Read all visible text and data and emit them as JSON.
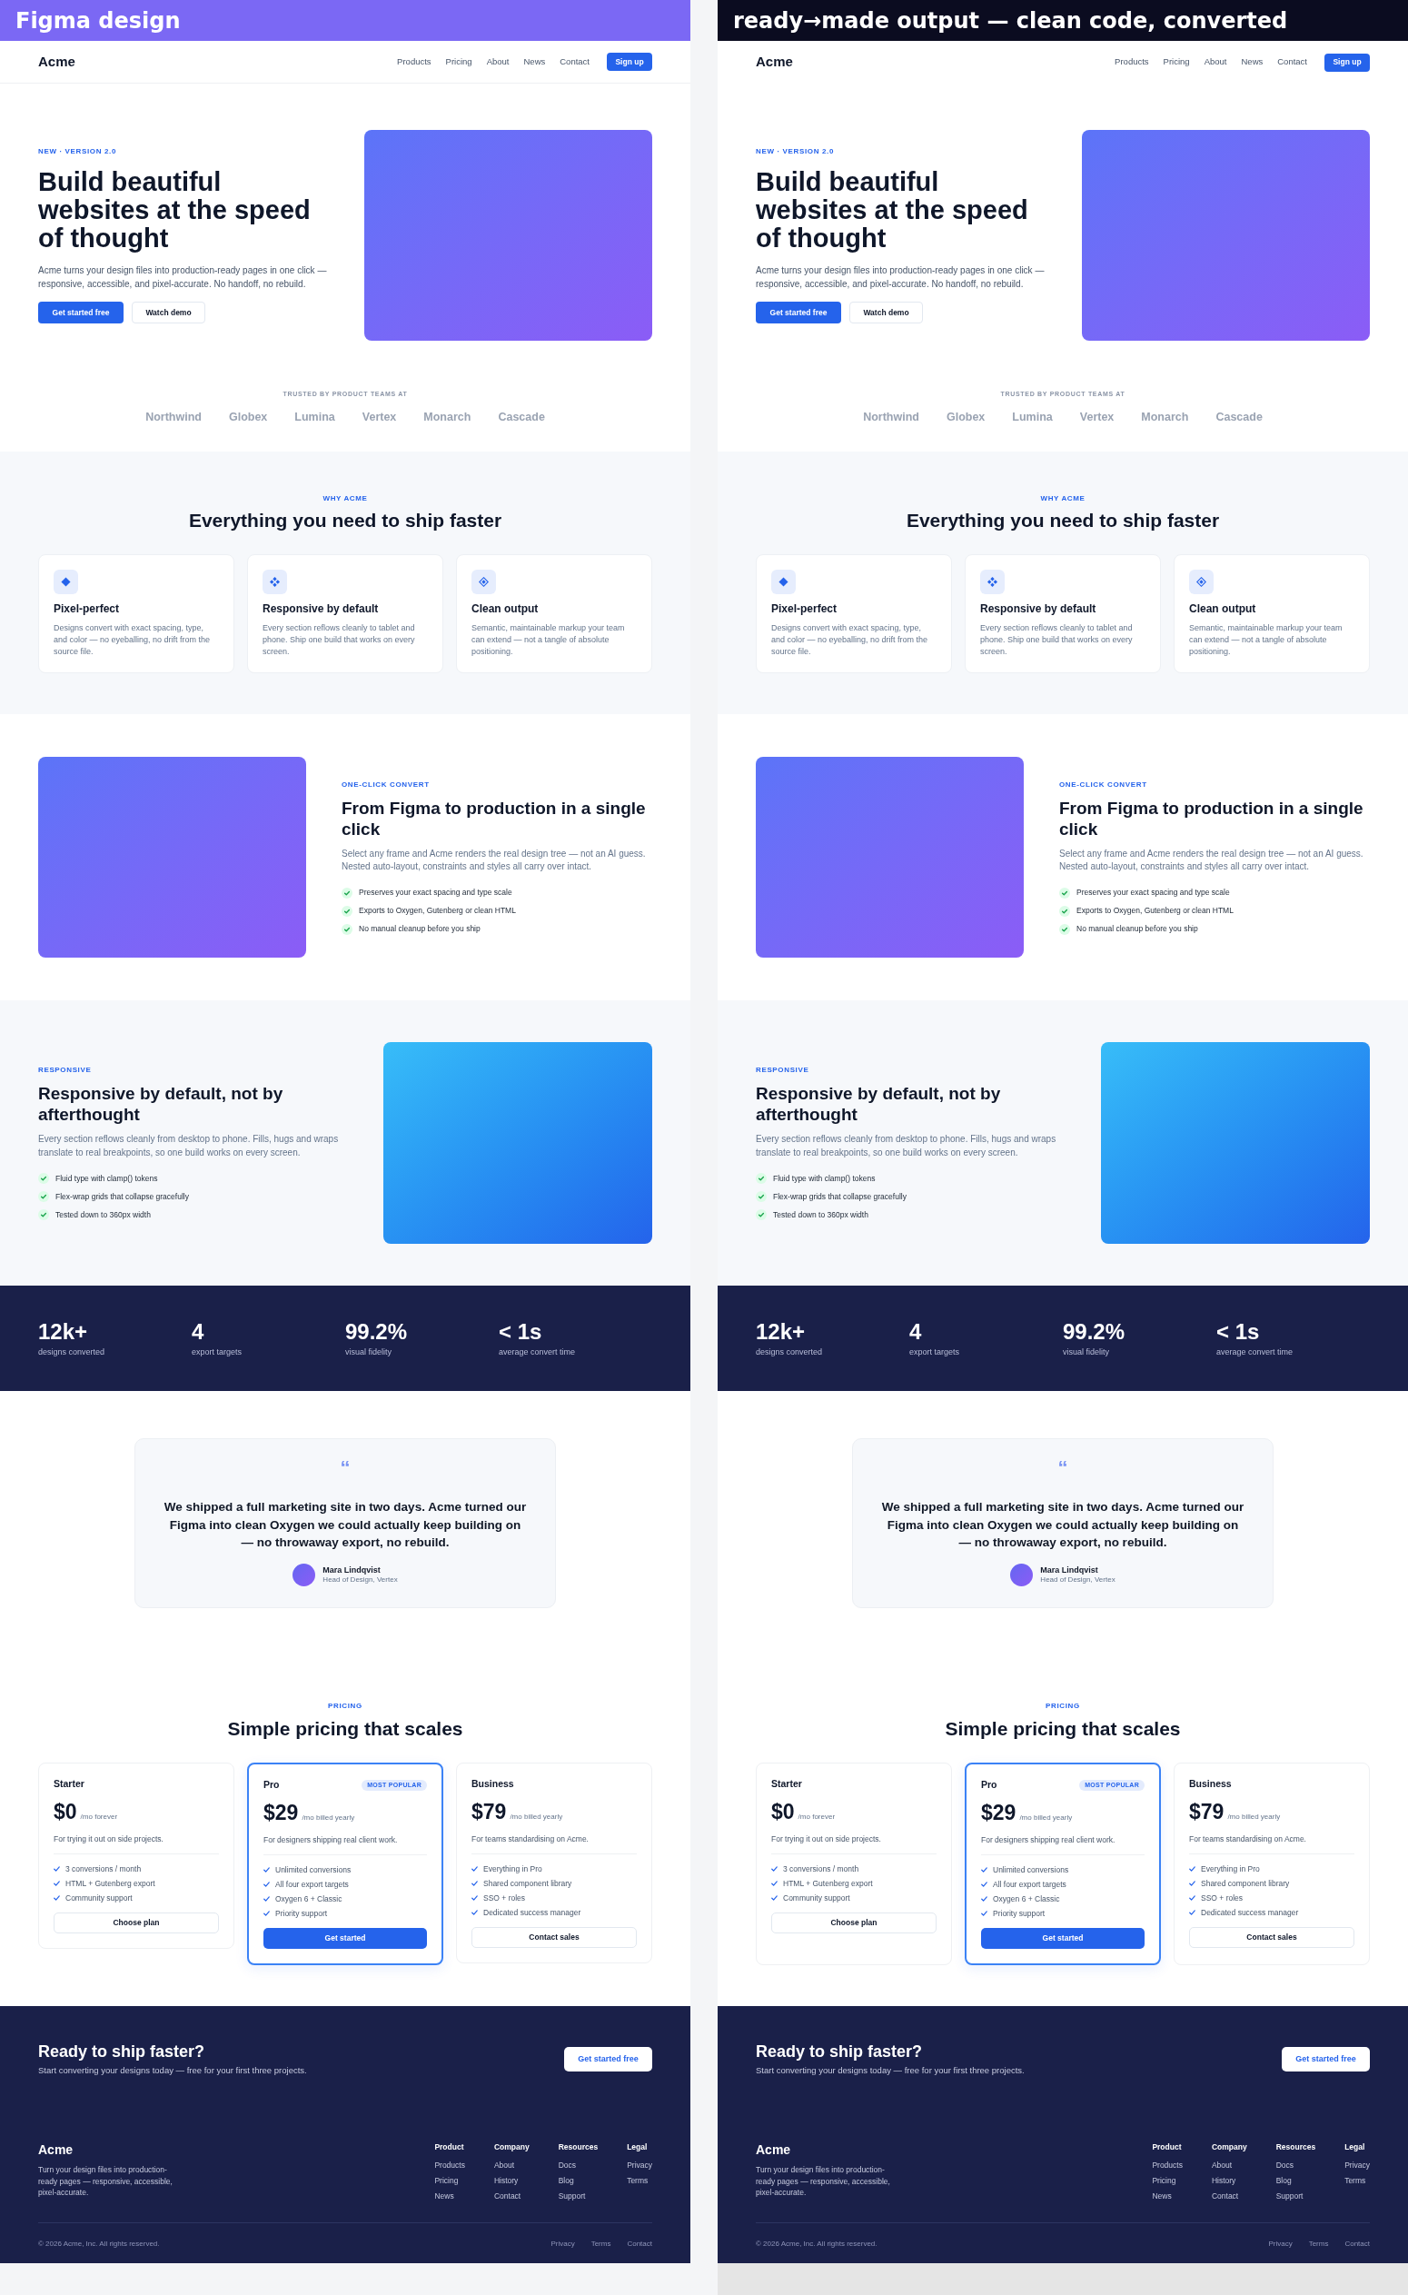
{
  "panels": [
    {
      "kind": "design",
      "label": "Figma design",
      "site": {
        "nav": {
          "logo": "Acme",
          "links": [
            "Products",
            "Pricing",
            "About",
            "News",
            "Contact"
          ],
          "button": "Sign up"
        },
        "hero": {
          "eyebrow": "NEW · VERSION 2.0",
          "title": "Build beautiful websites at the speed of thought",
          "text": "Acme turns your design files into production-ready pages in one click — responsive, accessible, and pixel-accurate. No handoff, no rebuild.",
          "buttons": [
            {
              "label": "Get started free",
              "kind": "primary"
            },
            {
              "label": "Watch demo",
              "kind": "secondary"
            }
          ]
        },
        "trusted": {
          "label": "TRUSTED BY PRODUCT TEAMS AT",
          "logos": [
            "Northwind",
            "Globex",
            "Lumina",
            "Vertex",
            "Monarch",
            "Cascade"
          ]
        },
        "features": {
          "eyebrow": "WHY ACME",
          "title": "Everything you need to ship faster",
          "cards": [
            {
              "title": "Pixel-perfect",
              "text": "Designs convert with exact spacing, type, and color — no eyeballing, no drift from the source file."
            },
            {
              "title": "Responsive by default",
              "text": "Every section reflows cleanly to tablet and phone. Ship one build that works on every screen."
            },
            {
              "title": "Clean output",
              "text": "Semantic, maintainable markup your team can extend — not a tangle of absolute positioning."
            }
          ]
        },
        "convert": {
          "eyebrow": "ONE-CLICK CONVERT",
          "title": "From Figma to production in a single click",
          "text": "Select any frame and Acme renders the real design tree — not an AI guess. Nested auto-layout, constraints and styles all carry over intact.",
          "points": [
            "Preserves your exact spacing and type scale",
            "Exports to Oxygen, Gutenberg or clean HTML",
            "No manual cleanup before you ship"
          ]
        },
        "responsive": {
          "eyebrow": "RESPONSIVE",
          "title": "Responsive by default, not by afterthought",
          "text": "Every section reflows cleanly from desktop to phone. Fills, hugs and wraps translate to real breakpoints, so one build works on every screen.",
          "points": [
            "Fluid type with clamp() tokens",
            "Flex-wrap grids that collapse gracefully",
            "Tested down to 360px width"
          ]
        },
        "stats": [
          {
            "value": "12k+",
            "label": "designs converted"
          },
          {
            "value": "4",
            "label": "export targets"
          },
          {
            "value": "99.2%",
            "label": "visual fidelity"
          },
          {
            "value": "< 1s",
            "label": "average convert time"
          }
        ],
        "testimonial": {
          "quote_mark": "“",
          "quote": "We shipped a full marketing site in two days. Acme turned our Figma into clean Oxygen we could actually keep building on — no throwaway export, no rebuild.",
          "name": "Mara Lindqvist",
          "role": "Head of Design, Vertex"
        },
        "pricing": {
          "eyebrow": "PRICING",
          "title": "Simple pricing that scales",
          "plans": [
            {
              "name": "Starter",
              "price": "$0",
              "period": "/mo forever",
              "description": "For trying it out on side projects.",
              "features": [
                "3 conversions / month",
                "HTML + Gutenberg export",
                "Community support"
              ],
              "button": "Choose plan",
              "highlighted": false
            },
            {
              "name": "Pro",
              "badge": "MOST POPULAR",
              "price": "$29",
              "period": "/mo billed yearly",
              "description": "For designers shipping real client work.",
              "features": [
                "Unlimited conversions",
                "All four export targets",
                "Oxygen 6 + Classic",
                "Priority support"
              ],
              "button": "Get started",
              "highlighted": true
            },
            {
              "name": "Business",
              "price": "$79",
              "period": "/mo billed yearly",
              "description": "For teams standardising on Acme.",
              "features": [
                "Everything in Pro",
                "Shared component library",
                "SSO + roles",
                "Dedicated success manager"
              ],
              "button": "Contact sales",
              "highlighted": false
            }
          ]
        },
        "cta": {
          "title": "Ready to ship faster?",
          "text": "Start converting your designs today — free for your first three projects.",
          "button": "Get started free"
        },
        "footer": {
          "brand": "Acme",
          "text": "Turn your design files into production-ready pages — responsive, accessible, pixel-accurate.",
          "columns": [
            {
              "heading": "Product",
              "links": [
                "Products",
                "Pricing",
                "News"
              ]
            },
            {
              "heading": "Company",
              "links": [
                "About",
                "History",
                "Contact"
              ]
            },
            {
              "heading": "Resources",
              "links": [
                "Docs",
                "Blog",
                "Support"
              ]
            },
            {
              "heading": "Legal",
              "links": [
                "Privacy",
                "Terms"
              ]
            }
          ],
          "copyright": "© 2026 Acme, Inc. All rights reserved.",
          "legal_links": [
            "Privacy",
            "Terms",
            "Contact"
          ]
        }
      }
    },
    {
      "kind": "output",
      "label": "ready→made output — clean code, converted",
      "site": {
        "nav": {
          "logo": "Acme",
          "links": [
            "Products",
            "Pricing",
            "About",
            "News",
            "Contact"
          ],
          "button": "Sign up"
        },
        "hero": {
          "eyebrow": "NEW · VERSION 2.0",
          "title": "Build beautiful websites at the speed of thought",
          "text": "Acme turns your design files into production-ready pages in one click — responsive, accessible, and pixel-accurate. No handoff, no rebuild.",
          "buttons": [
            {
              "label": "Get started free",
              "kind": "primary"
            },
            {
              "label": "Watch demo",
              "kind": "secondary"
            }
          ]
        },
        "trusted": {
          "label": "TRUSTED BY PRODUCT TEAMS AT",
          "logos": [
            "Northwind",
            "Globex",
            "Lumina",
            "Vertex",
            "Monarch",
            "Cascade"
          ]
        },
        "features": {
          "eyebrow": "WHY ACME",
          "title": "Everything you need to ship faster",
          "cards": [
            {
              "title": "Pixel-perfect",
              "text": "Designs convert with exact spacing, type, and color — no eyeballing, no drift from the source file."
            },
            {
              "title": "Responsive by default",
              "text": "Every section reflows cleanly to tablet and phone. Ship one build that works on every screen."
            },
            {
              "title": "Clean output",
              "text": "Semantic, maintainable markup your team can extend — not a tangle of absolute positioning."
            }
          ]
        },
        "convert": {
          "eyebrow": "ONE-CLICK CONVERT",
          "title": "From Figma to production in a single click",
          "text": "Select any frame and Acme renders the real design tree — not an AI guess. Nested auto-layout, constraints and styles all carry over intact.",
          "points": [
            "Preserves your exact spacing and type scale",
            "Exports to Oxygen, Gutenberg or clean HTML",
            "No manual cleanup before you ship"
          ]
        },
        "responsive": {
          "eyebrow": "RESPONSIVE",
          "title": "Responsive by default, not by afterthought",
          "text": "Every section reflows cleanly from desktop to phone. Fills, hugs and wraps translate to real breakpoints, so one build works on every screen.",
          "points": [
            "Fluid type with clamp() tokens",
            "Flex-wrap grids that collapse gracefully",
            "Tested down to 360px width"
          ]
        },
        "stats": [
          {
            "value": "12k+",
            "label": "designs converted"
          },
          {
            "value": "4",
            "label": "export targets"
          },
          {
            "value": "99.2%",
            "label": "visual fidelity"
          },
          {
            "value": "< 1s",
            "label": "average convert time"
          }
        ],
        "testimonial": {
          "quote_mark": "“",
          "quote": "We shipped a full marketing site in two days. Acme turned our Figma into clean Oxygen we could actually keep building on — no throwaway export, no rebuild.",
          "name": "Mara Lindqvist",
          "role": "Head of Design, Vertex"
        },
        "pricing": {
          "eyebrow": "PRICING",
          "title": "Simple pricing that scales",
          "plans": [
            {
              "name": "Starter",
              "price": "$0",
              "period": "/mo forever",
              "description": "For trying it out on side projects.",
              "features": [
                "3 conversions / month",
                "HTML + Gutenberg export",
                "Community support"
              ],
              "button": "Choose plan",
              "highlighted": false
            },
            {
              "name": "Pro",
              "badge": "MOST POPULAR",
              "price": "$29",
              "period": "/mo billed yearly",
              "description": "For designers shipping real client work.",
              "features": [
                "Unlimited conversions",
                "All four export targets",
                "Oxygen 6 + Classic",
                "Priority support"
              ],
              "button": "Get started",
              "highlighted": true
            },
            {
              "name": "Business",
              "price": "$79",
              "period": "/mo billed yearly",
              "description": "For teams standardising on Acme.",
              "features": [
                "Everything in Pro",
                "Shared component library",
                "SSO + roles",
                "Dedicated success manager"
              ],
              "button": "Contact sales",
              "highlighted": false
            }
          ]
        },
        "cta": {
          "title": "Ready to ship faster?",
          "text": "Start converting your designs today — free for your first three projects.",
          "button": "Get started free"
        },
        "footer": {
          "brand": "Acme",
          "text": "Turn your design files into production-ready pages — responsive, accessible, pixel-accurate.",
          "columns": [
            {
              "heading": "Product",
              "links": [
                "Products",
                "Pricing",
                "News"
              ]
            },
            {
              "heading": "Company",
              "links": [
                "About",
                "History",
                "Contact"
              ]
            },
            {
              "heading": "Resources",
              "links": [
                "Docs",
                "Blog",
                "Support"
              ]
            },
            {
              "heading": "Legal",
              "links": [
                "Privacy",
                "Terms"
              ]
            }
          ],
          "copyright": "© 2026 Acme, Inc. All rights reserved.",
          "legal_links": [
            "Privacy",
            "Terms",
            "Contact"
          ]
        }
      }
    }
  ]
}
